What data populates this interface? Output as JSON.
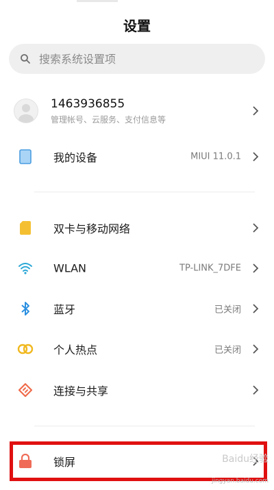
{
  "header": {
    "title": "设置"
  },
  "search": {
    "placeholder": "搜索系统设置项",
    "icon": "search-icon"
  },
  "account": {
    "name": "1463936855",
    "subtitle": "管理帐号、云服务、支付信息等",
    "icon": "avatar"
  },
  "device": {
    "label": "我的设备",
    "value": "MIUI 11.0.1",
    "icon": "tablet-icon",
    "color": "#5aa7e8"
  },
  "network": [
    {
      "label": "双卡与移动网络",
      "value": "",
      "icon": "sim-card-icon",
      "color": "#f4c032"
    },
    {
      "label": "WLAN",
      "value": "TP-LINK_7DFE",
      "icon": "wifi-icon",
      "color": "#2aa7d6"
    },
    {
      "label": "蓝牙",
      "value": "已关闭",
      "icon": "bluetooth-icon",
      "color": "#2a8fe0"
    },
    {
      "label": "个人热点",
      "value": "已关闭",
      "icon": "hotspot-icon",
      "color": "#f0b81e"
    },
    {
      "label": "连接与共享",
      "value": "",
      "icon": "share-icon",
      "color": "#ef6b4a"
    }
  ],
  "lock": {
    "label": "锁屏",
    "icon": "lock-icon",
    "color": "#ef6b57"
  },
  "watermark": {
    "text": "Baidu经验",
    "sub": "jingyan.baidu.com"
  },
  "colors": {
    "highlight": "#e01010",
    "background": "#ffffff",
    "search_bg": "#efefef"
  }
}
